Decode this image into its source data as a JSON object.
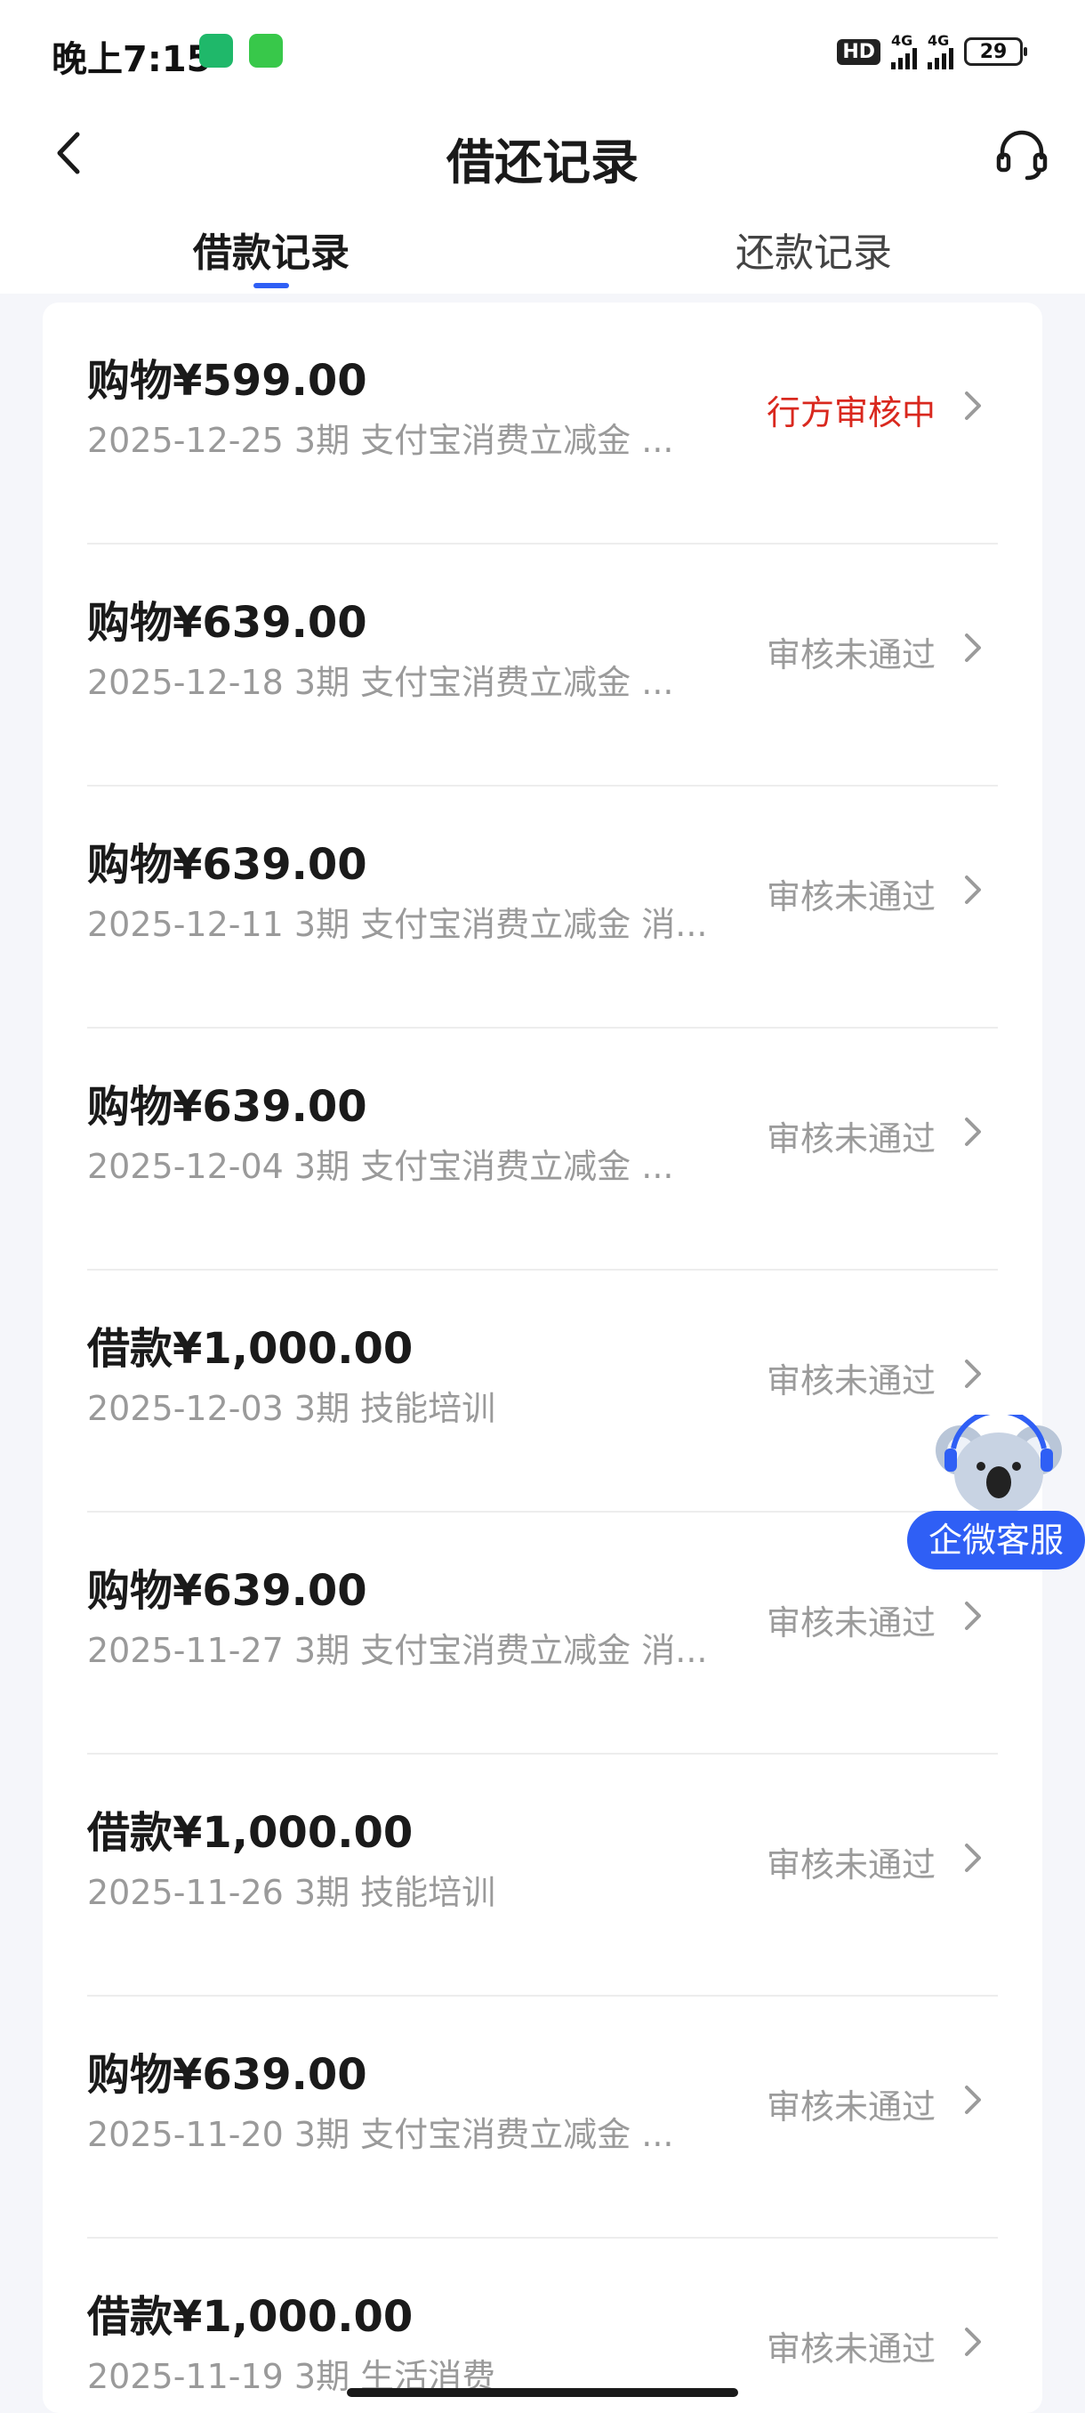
{
  "status_bar": {
    "time": "晚上7:15",
    "network_1": "4G",
    "network_2": "4G",
    "hd": "HD",
    "battery": "29"
  },
  "header": {
    "title": "借还记录",
    "back_icon": "chevron-left-icon",
    "service_icon": "headset-icon"
  },
  "tabs": [
    {
      "label": "借款记录",
      "active": true
    },
    {
      "label": "还款记录",
      "active": false
    }
  ],
  "records": [
    {
      "title": "购物¥599.00",
      "subtitle": "2025-12-25 3期  支付宝消费立减金 ...",
      "status": "行方审核中",
      "status_color": "#d9281e"
    },
    {
      "title": "购物¥639.00",
      "subtitle": "2025-12-18 3期  支付宝消费立减金 ...",
      "status": "审核未通过",
      "status_color": "#9b9b9b"
    },
    {
      "title": "购物¥639.00",
      "subtitle": "2025-12-11 3期  支付宝消费立减金 消...",
      "status": "审核未通过",
      "status_color": "#9b9b9b"
    },
    {
      "title": "购物¥639.00",
      "subtitle": "2025-12-04 3期  支付宝消费立减金 ...",
      "status": "审核未通过",
      "status_color": "#9b9b9b"
    },
    {
      "title": "借款¥1,000.00",
      "subtitle": "2025-12-03 3期  技能培训",
      "status": "审核未通过",
      "status_color": "#9b9b9b"
    },
    {
      "title": "购物¥639.00",
      "subtitle": "2025-11-27 3期  支付宝消费立减金 消...",
      "status": "审核未通过",
      "status_color": "#9b9b9b"
    },
    {
      "title": "借款¥1,000.00",
      "subtitle": "2025-11-26 3期  技能培训",
      "status": "审核未通过",
      "status_color": "#9b9b9b"
    },
    {
      "title": "购物¥639.00",
      "subtitle": "2025-11-20 3期  支付宝消费立减金 ...",
      "status": "审核未通过",
      "status_color": "#9b9b9b"
    },
    {
      "title": "借款¥1,000.00",
      "subtitle": "2025-11-19 3期  生活消费",
      "status": "审核未通过",
      "status_color": "#9b9b9b"
    }
  ],
  "float_service": {
    "label": "企微客服",
    "icon": "koala-mascot-icon"
  },
  "colors": {
    "accent": "#2f5ff5",
    "pending": "#d9281e",
    "muted": "#9b9b9b"
  }
}
